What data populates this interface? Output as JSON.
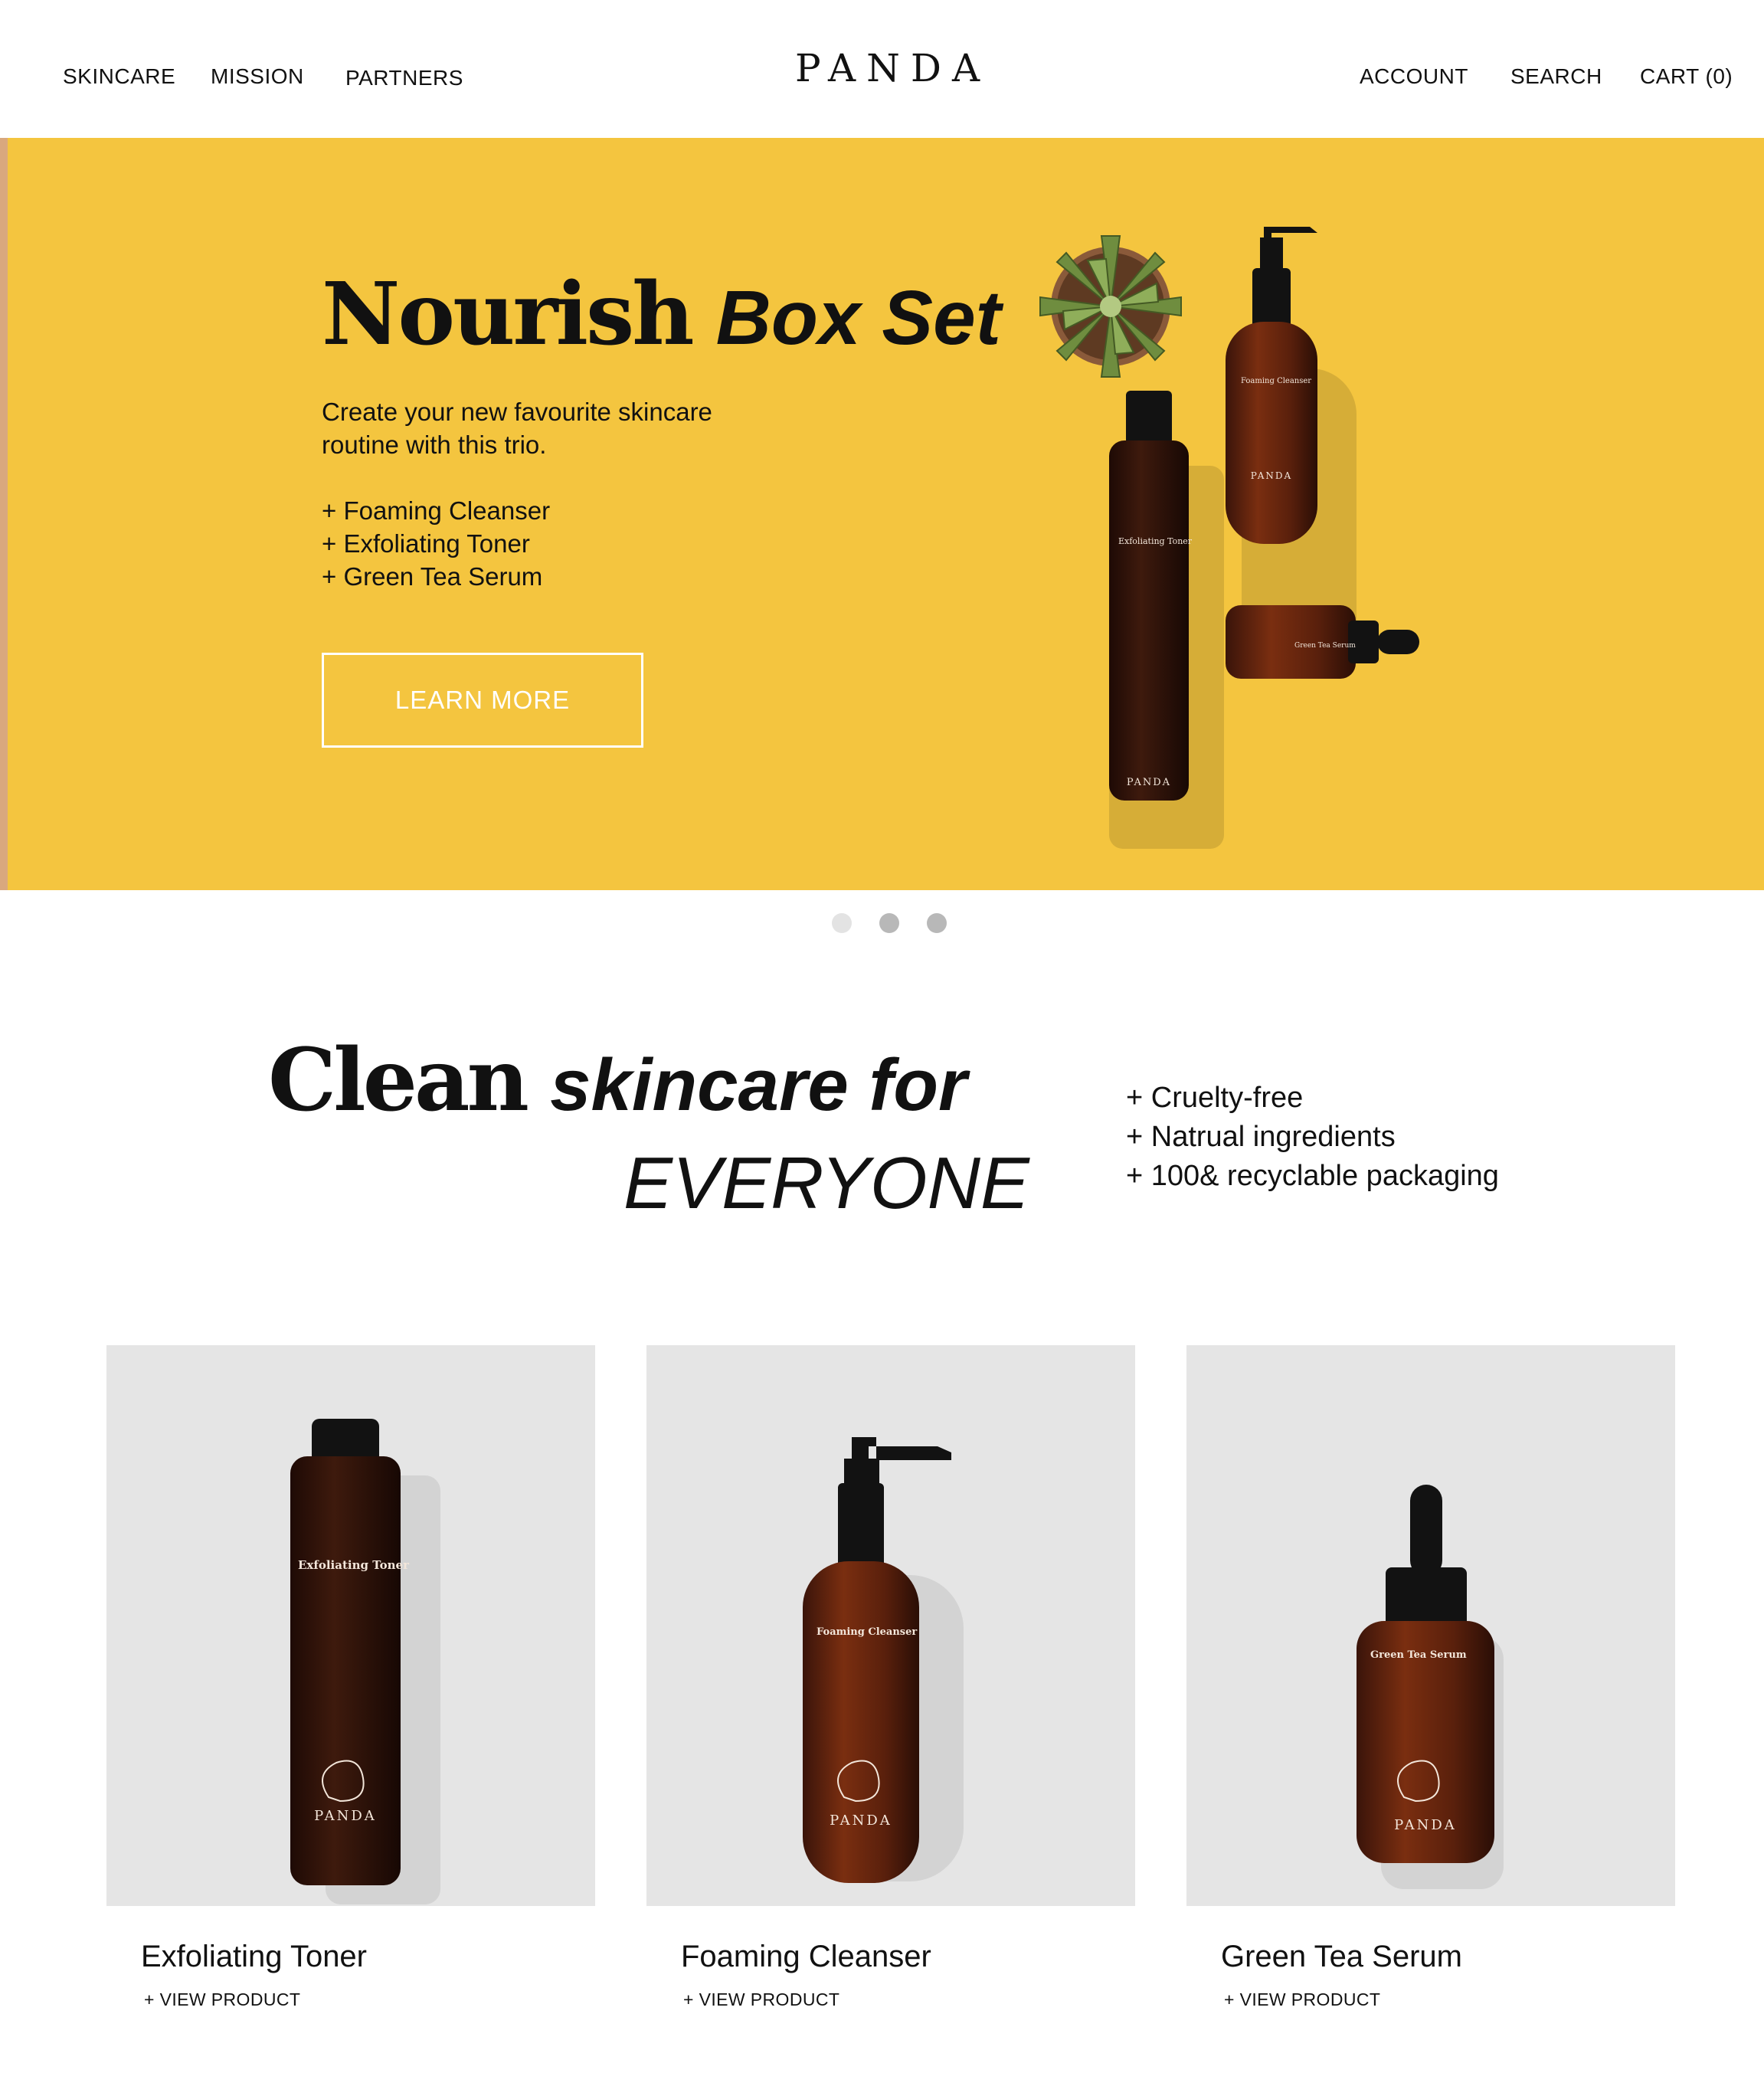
{
  "nav": {
    "left": [
      "SKINCARE",
      "MISSION",
      "PARTNERS"
    ],
    "logo": "PANDA",
    "account": "ACCOUNT",
    "search": "SEARCH",
    "cart": "CART (0)"
  },
  "hero": {
    "title_main": "Nourish",
    "title_accent": "Box Set",
    "description_line1": "Create your new favourite skincare",
    "description_line2": "routine with this trio.",
    "items": [
      "+ Foaming Cleanser",
      "+ Exfoliating Toner",
      "+ Green Tea Serum"
    ],
    "cta_label": "LEARN MORE",
    "bottle_labels": {
      "cleanser": "Foaming Cleanser",
      "toner": "Exfoliating Toner",
      "serum": "Green Tea Serum",
      "brand": "PANDA"
    }
  },
  "carousel": {
    "slide_count": 3,
    "active_index": 0
  },
  "intro": {
    "headline_main": "Clean",
    "headline_accent": "skincare for",
    "headline_line2": "EVERYONE",
    "features": [
      "+ Cruelty-free",
      "+ Natrual ingredients",
      "+ 100& recyclable packaging"
    ]
  },
  "products": [
    {
      "name": "Exfoliating Toner",
      "link": "+ VIEW PRODUCT"
    },
    {
      "name": "Foaming Cleanser",
      "link": "+ VIEW PRODUCT"
    },
    {
      "name": "Green Tea Serum",
      "link": "+ VIEW PRODUCT"
    }
  ],
  "colors": {
    "hero_bg": "#f4c53f",
    "card_bg": "#e5e5e5",
    "bottle_amber": "#6b2a10",
    "cap_black": "#121212",
    "dot_active": "#e3e3e3",
    "dot_inactive": "#b8b8b8"
  }
}
